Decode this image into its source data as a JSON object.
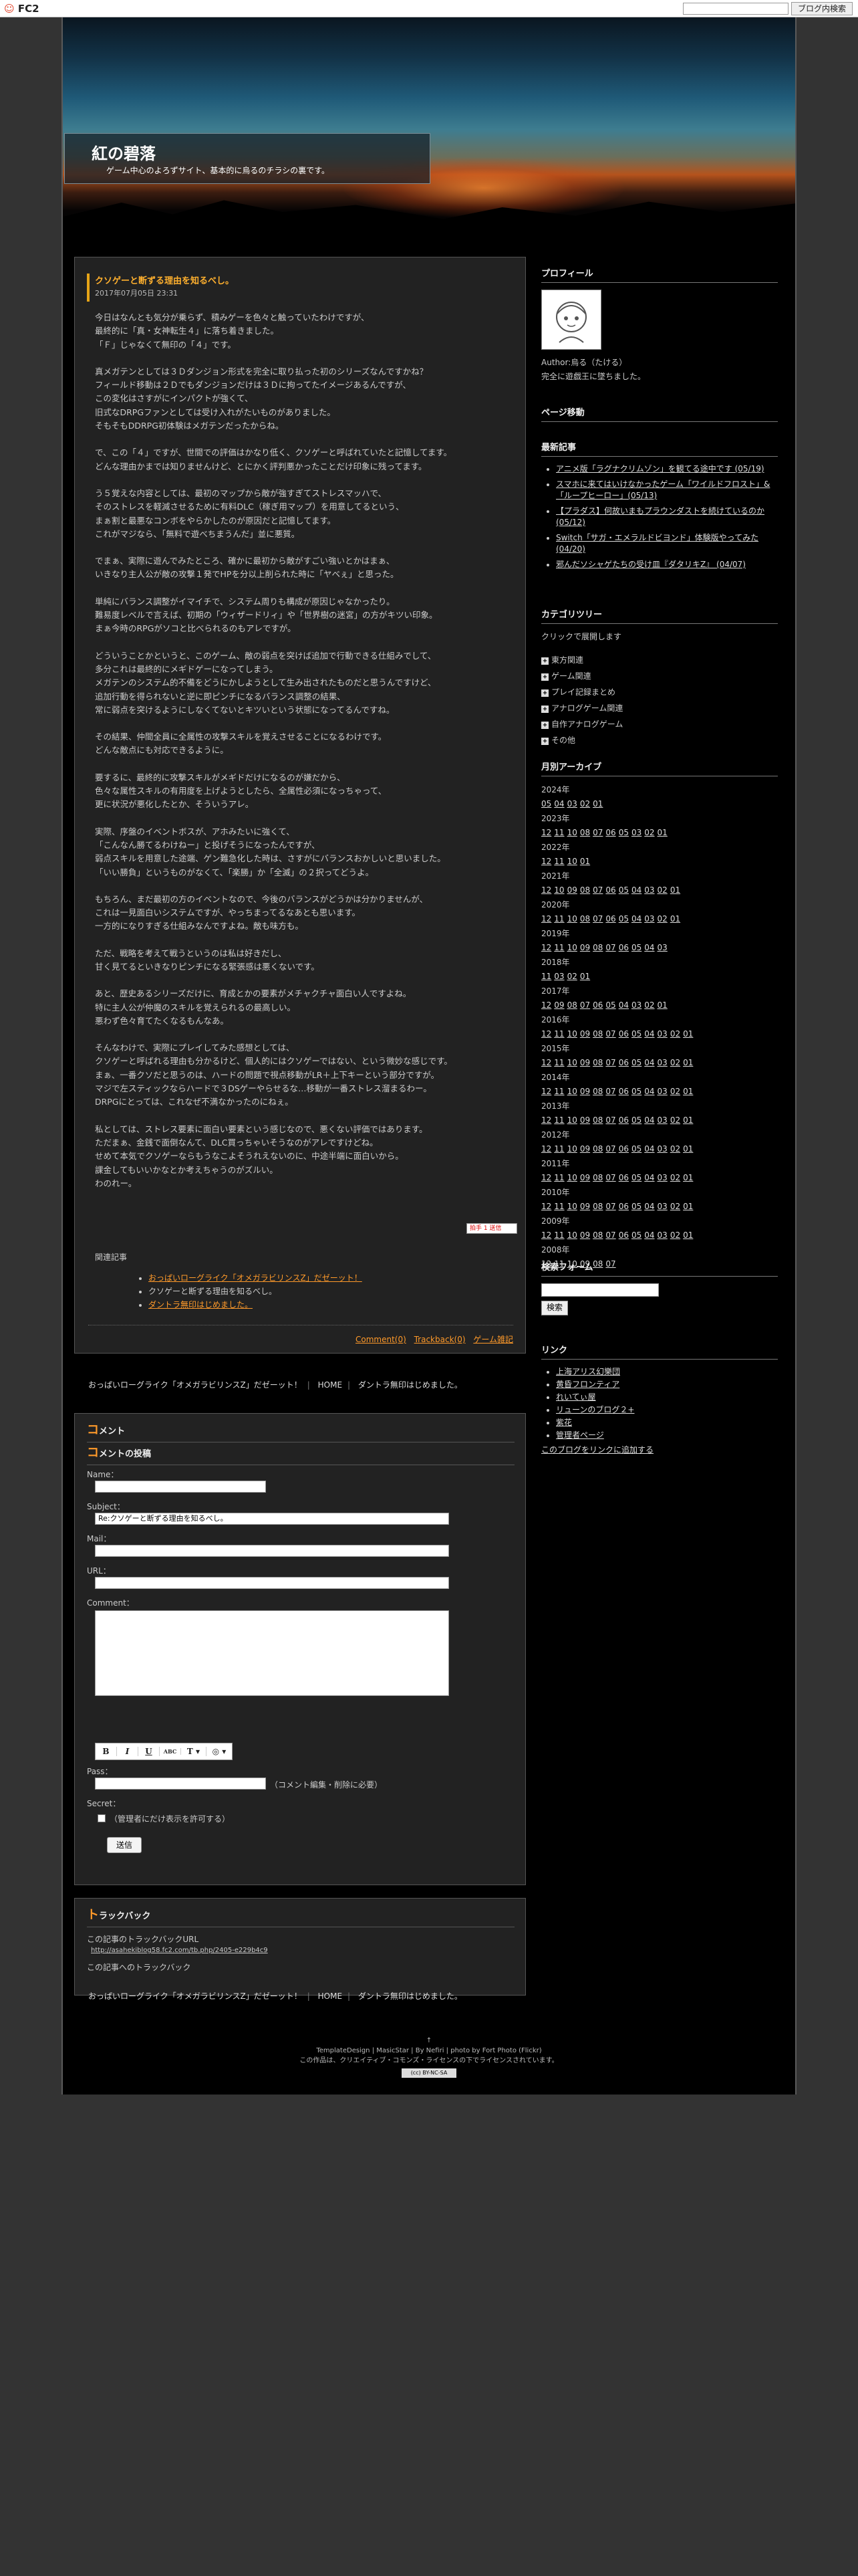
{
  "fc2bar": {
    "logo": "FC2",
    "search_placeholder": "",
    "search_button": "ブログ内検索"
  },
  "header": {
    "title": "紅の碧落",
    "description": "ゲーム中心のよろずサイト、基本的に烏るのチラシの裏です。"
  },
  "entry": {
    "title": "クソゲーと断ずる理由を知るべし。",
    "date": "2017年07月05日 23:31",
    "paragraphs": [
      "今日はなんとも気分が乗らず、積みゲーを色々と触っていたわけですが、\n最終的に「真・女神転生４」に落ち着きました。\n「Ｆ」じゃなくて無印の「４」です。",
      "真メガテンとしては３Ｄダンジョン形式を完全に取り払った初のシリーズなんですかね？\nフィールド移動は２Ｄでもダンジョンだけは３Ｄに拘ってたイメージあるんですが、\nこの変化はさすがにインパクトが強くて、\n旧式なDRPGファンとしては受け入れがたいものがありました。\nそもそもDDRPG初体験はメガテンだったからね。",
      "で、この「４」ですが、世間での評価はかなり低く、クソゲーと呼ばれていたと記憶してます。\nどんな理由かまでは知りませんけど、とにかく評判悪かったことだけ印象に残ってます。",
      "う５覚えな内容としては、最初のマップから敵が強すぎてストレスマッハで、\nそのストレスを軽減させるために有料DLC（稼ぎ用マップ）を用意してるという、\nまぁ割と最悪なコンボをやらかしたのが原因だと記憶してます。\nこれがマジなら、「無料で遊べちまうんだ」並に悪質。",
      "でまぁ、実際に遊んでみたところ、確かに最初から敵がすごい強いとかはまぁ、\nいきなり主人公が敵の攻撃１発でHPを分以上削られた時に「ヤベぇ」と思った。",
      "単純にバランス調整がイマイチで、システム周りも構成が原因じゃなかったり。\n難易度レベルで言えば、初期の「ウィザードリィ」や「世界樹の迷宮」の方がキツい印象。\nまぁ今時のRPGがソコと比べられるのもアレですが。",
      "どういうことかというと、このゲーム、敵の弱点を突けば追加で行動できる仕組みでして、\n多分これは最終的にメギドゲーになってしまう。\nメガテンのシステム的不備をどうにかしようとして生み出されたものだと思うんですけど、\n追加行動を得られないと逆に即ピンチになるバランス調整の結果、\n常に弱点を突けるようにしなくてないとキツいという状態になってるんですね。",
      "その結果、仲間全員に全属性の攻撃スキルを覚えさせることになるわけです。\nどんな敵点にも対応できるように。",
      "要するに、最終的に攻撃スキルがメギドだけになるのが嫌だから、\n色々な属性スキルの有用度を上げようとしたら、全属性必須になっちゃって、\n更に状況が悪化したとか、そういうアレ。",
      "実際、序盤のイベントボスが、アホみたいに強くて、\n「こんなん勝てるわけねー」と投げそうになったんですが、\n弱点スキルを用意した途端、ゲン難急化した時は、さすがにバランスおかしいと思いました。\n「いい勝負」というものがなくて、「楽勝」か「全滅」の２択ってどうよ。",
      "もちろん、まだ最初の方のイベントなので、今後のバランスがどうかは分かりませんが、\nこれは一見面白いシステムですが、やっちまってるなあとも思います。\n一方的になりすぎる仕組みなんですよね。敵も味方も。",
      "ただ、戦略を考えて戦うというのは私は好きだし、\n甘く見てるといきなりピンチになる緊張感は悪くないです。",
      "あと、歴史あるシリーズだけに、育成とかの要素がメチャクチャ面白い人ですよね。\n特に主人公が仲魔のスキルを覚えられるの最高しい。\n悪わず色々育てたくなるもんなあ。",
      "そんなわけで、実際にプレイしてみた感想としては、\nクソゲーと呼ばれる理由も分かるけど、個人的にはクソゲーではない、という微妙な感じです。\nまぁ、一番クソだと思うのは、ハードの問題で視点移動がLR＋上下キーという部分ですが。\nマジで左スティックならハードで３DSゲーやらせるな…移動が一番ストレス溜まるわー。\nDRPGにとっては、これなぜ不満なかったのにねぇ。",
      "私としては、ストレス要素に面白い要素という感じなので、悪くない評価ではあります。\nただまぁ、金銭で面倒なんて、DLC買っちゃいそうなのがアレですけどね。\nせめて本気でクソゲーならもうなこよそうれえないのに、中途半端に面白いから。\n課金してもいいかなとか考えちゃうのがズルい。\nわのれー。"
    ],
    "clap_label": "拍手 1 送信",
    "related_heading": "関連記事",
    "related": [
      "おっぱいローグライク「オメガラビリンスZ」だゼーット！",
      "クソゲーと断ずる理由を知るべし。",
      "ダントラ無印はじめました。"
    ],
    "footer_links": [
      "Comment(0)",
      "Trackback(0)",
      "ゲーム雑記"
    ]
  },
  "pager": {
    "prev": "おっぱいローグライク「オメガラビリンスZ」だゼーット！",
    "home": "HOME",
    "next": "ダントラ無印はじめました。"
  },
  "comment": {
    "section_title": "メント",
    "form_title": "メントの投稿",
    "labels": {
      "name": "Name：",
      "subject": "Subject：",
      "mail": "Mail：",
      "url": "URL：",
      "comment": "Comment：",
      "pass": "Pass：",
      "secret": "Secret："
    },
    "subject_value": "Re:クソゲーと断ずる理由を知るべし。",
    "pass_note": "（コメント編集・削除に必要）",
    "secret_note": "（管理者にだけ表示を許可する）",
    "submit": "送信",
    "toolbar": [
      "B",
      "I",
      "U",
      "ABC",
      "T ▾",
      "◎ ▾"
    ]
  },
  "trackback": {
    "section_title": "ラックバック",
    "url_label": "この記事のトラックバックURL",
    "url": "http://asahekiblog58.fc2.com/tb.php/2405-e229b4c9",
    "link_text": "この記事へのトラックバック"
  },
  "sidebar": {
    "profile": {
      "title": "プロフィール",
      "author": "Author:烏る（たける）",
      "text": "完全に遊戯王に墜ちました。"
    },
    "page_nav": {
      "title": "ページ移動"
    },
    "recent": {
      "title": "最新記事",
      "items": [
        "アニメ版「ラグナクリムゾン」を観てる途中です (05/19)",
        "スマホに来てはいけなかったゲーム「ワイルドフロスト」&「ループヒーロー」(05/13)",
        "【プラダス】何故いまもプラウンダストを続けているのか(05/12)",
        "Switch「サガ・エメラルドビヨンド」体験版やってみた (04/20)",
        "邪んだソシャゲたちの受け皿『ダタリキZ』 (04/07)"
      ]
    },
    "category": {
      "title": "カテゴリツリー",
      "note": "クリックで展開します",
      "items": [
        "東方関連",
        "ゲーム関連",
        "プレイ記録まとめ",
        "アナログゲーム関連",
        "自作アナログゲーム",
        "その他"
      ]
    },
    "archive": {
      "title": "月別アーカイブ",
      "years": [
        {
          "year": "2024年",
          "months": [
            "05",
            "04",
            "03",
            "02",
            "01"
          ]
        },
        {
          "year": "2023年",
          "months": [
            "12",
            "11",
            "10",
            "08",
            "07",
            "06",
            "05",
            "03",
            "02",
            "01"
          ]
        },
        {
          "year": "2022年",
          "months": [
            "12",
            "11",
            "10",
            "01"
          ]
        },
        {
          "year": "2021年",
          "months": [
            "12",
            "10",
            "09",
            "08",
            "07",
            "06",
            "05",
            "04",
            "03",
            "02",
            "01"
          ]
        },
        {
          "year": "2020年",
          "months": [
            "12",
            "11",
            "10",
            "08",
            "07",
            "06",
            "05",
            "04",
            "03",
            "02",
            "01"
          ]
        },
        {
          "year": "2019年",
          "months": [
            "12",
            "11",
            "10",
            "09",
            "08",
            "07",
            "06",
            "05",
            "04",
            "03"
          ]
        },
        {
          "year": "2018年",
          "months": [
            "11",
            "03",
            "02",
            "01"
          ]
        },
        {
          "year": "2017年",
          "months": [
            "12",
            "09",
            "08",
            "07",
            "06",
            "05",
            "04",
            "03",
            "02",
            "01"
          ]
        },
        {
          "year": "2016年",
          "months": [
            "12",
            "11",
            "10",
            "09",
            "08",
            "07",
            "06",
            "05",
            "04",
            "03",
            "02",
            "01"
          ]
        },
        {
          "year": "2015年",
          "months": [
            "12",
            "11",
            "10",
            "09",
            "08",
            "07",
            "06",
            "05",
            "04",
            "03",
            "02",
            "01"
          ]
        },
        {
          "year": "2014年",
          "months": [
            "12",
            "11",
            "10",
            "09",
            "08",
            "07",
            "06",
            "05",
            "04",
            "03",
            "02",
            "01"
          ]
        },
        {
          "year": "2013年",
          "months": [
            "12",
            "11",
            "10",
            "09",
            "08",
            "07",
            "06",
            "05",
            "04",
            "03",
            "02",
            "01"
          ]
        },
        {
          "year": "2012年",
          "months": [
            "12",
            "11",
            "10",
            "09",
            "08",
            "07",
            "06",
            "05",
            "04",
            "03",
            "02",
            "01"
          ]
        },
        {
          "year": "2011年",
          "months": [
            "12",
            "11",
            "10",
            "09",
            "08",
            "07",
            "06",
            "05",
            "04",
            "03",
            "02",
            "01"
          ]
        },
        {
          "year": "2010年",
          "months": [
            "12",
            "11",
            "10",
            "09",
            "08",
            "07",
            "06",
            "05",
            "04",
            "03",
            "02",
            "01"
          ]
        },
        {
          "year": "2009年",
          "months": [
            "12",
            "11",
            "10",
            "09",
            "08",
            "07",
            "06",
            "05",
            "04",
            "03",
            "02",
            "01"
          ]
        },
        {
          "year": "2008年",
          "months": [
            "12",
            "11",
            "10",
            "09",
            "08",
            "07"
          ]
        }
      ]
    },
    "search": {
      "title": "検索フォーム",
      "button": "検索"
    },
    "links": {
      "title": "リンク",
      "items": [
        "上海アリス幻樂団",
        "黄昏フロンティア",
        "れいてぃ屋",
        "リューンのブログ２+",
        "紫花",
        "管理者ページ"
      ],
      "add": "このブログをリンクに追加する"
    }
  },
  "footer": {
    "top": "↑",
    "credit": "TemplateDesign | MasicStar | By Nefiri | photo by Fort Photo (Flickr)",
    "license": "この作品は、クリエイティブ・コモンズ・ライセンスの下でライセンスされています。",
    "badge": "(cc) BY-NC-SA"
  },
  "colors": {
    "accent": "#ff9a2a",
    "title": "#ffb02e",
    "background": "#000000",
    "outer": "#333333"
  }
}
